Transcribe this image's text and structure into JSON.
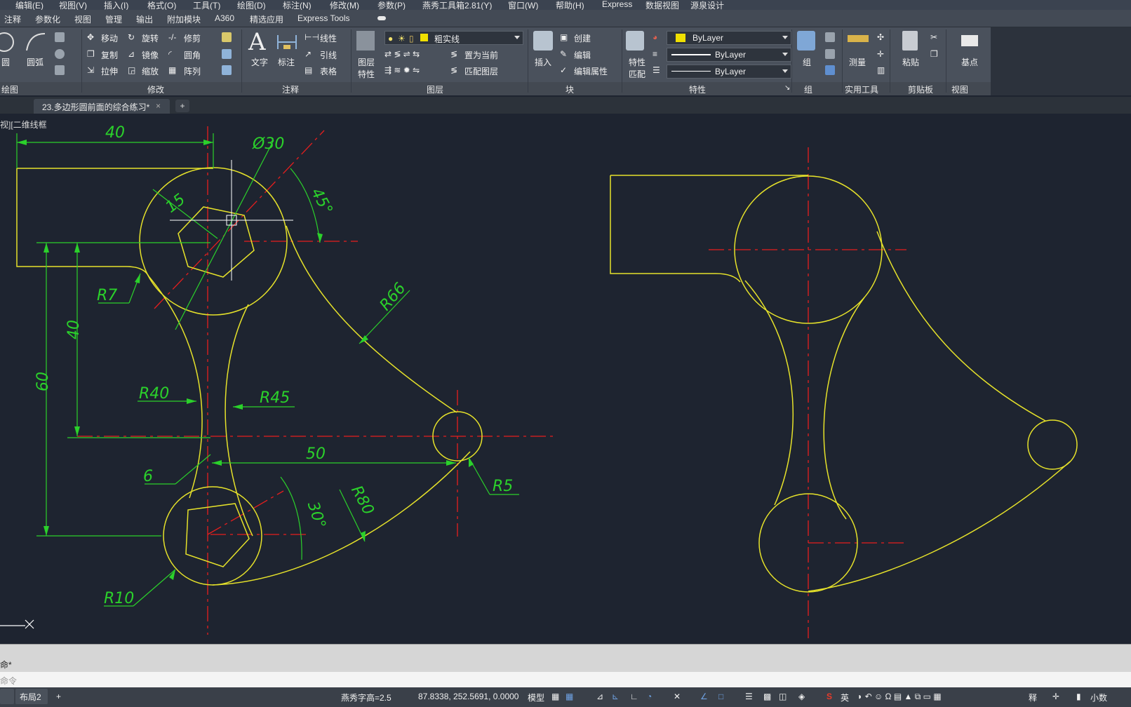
{
  "menu": [
    "编辑(E)",
    "视图(V)",
    "插入(I)",
    "格式(O)",
    "工具(T)",
    "绘图(D)",
    "标注(N)",
    "修改(M)",
    "参数(P)",
    "燕秀工具箱2.81(Y)",
    "窗口(W)",
    "帮助(H)",
    "Express",
    "数据视图",
    "源泉设计"
  ],
  "ribbon_tabs": [
    "注释",
    "参数化",
    "视图",
    "管理",
    "输出",
    "附加模块",
    "A360",
    "精选应用",
    "Express Tools"
  ],
  "ribbon": {
    "draw": {
      "circle": "圆",
      "arc": "圆弧",
      "title": "绘图"
    },
    "modify": {
      "move": "移动",
      "rotate": "旋转",
      "trim": "修剪",
      "copy": "复制",
      "mirror": "镜像",
      "fillet": "圆角",
      "stretch": "拉伸",
      "scale": "缩放",
      "array": "阵列",
      "title": "修改"
    },
    "annotation": {
      "text": "文字",
      "dimension": "标注",
      "linear": "线性",
      "leader": "引线",
      "table": "表格",
      "title": "注释"
    },
    "layers": {
      "layer_props_1": "图层",
      "layer_props_2": "特性",
      "current_layer": "粗实线",
      "set_current": "置为当前",
      "match_layer": "匹配图层",
      "title": "图层"
    },
    "block": {
      "insert": "插入",
      "create": "创建",
      "edit": "编辑",
      "edit_attr": "编辑属性",
      "title": "块"
    },
    "properties": {
      "match_1": "特性",
      "match_2": "匹配",
      "color": "ByLayer",
      "linetype": "ByLayer",
      "lineweight": "ByLayer",
      "title": "特性"
    },
    "groups": {
      "group": "组",
      "title": "组"
    },
    "utilities": {
      "measure": "测量",
      "title": "实用工具"
    },
    "clipboard": {
      "paste": "粘贴",
      "title": "剪贴板"
    },
    "view": {
      "base": "基点",
      "title": "视图"
    }
  },
  "document_tab": {
    "name": "23.多边形圆前面的综合练习*",
    "close": "×",
    "add": "+"
  },
  "viewport_label": "视][二维线框",
  "dimensions": {
    "d40_top": "40",
    "d30_dia": "Ø30",
    "d15": "15",
    "d45_ang": "45°",
    "r7": "R7",
    "r66": "R66",
    "d40_left": "40",
    "d60": "60",
    "r40": "R40",
    "r45": "R45",
    "d50": "50",
    "d6": "6",
    "r5": "R5",
    "r80": "R80",
    "d30_ang": "30°",
    "r10": "R10"
  },
  "command": {
    "history": "命*",
    "prompt": "命令"
  },
  "status": {
    "layout2": "布局2",
    "add": "+",
    "text_height": "燕秀字高=2.5",
    "coords": "87.8338, 252.5691, 0.0000",
    "model": "模型",
    "ime_lang": "英",
    "annotation": "释",
    "decimal": "小数"
  },
  "colors": {
    "drawing": "#e6e22a",
    "dimension": "#2bd12b",
    "center": "#e61e1e",
    "canvas": "#1e2430",
    "ribbon": "#4a515c"
  }
}
